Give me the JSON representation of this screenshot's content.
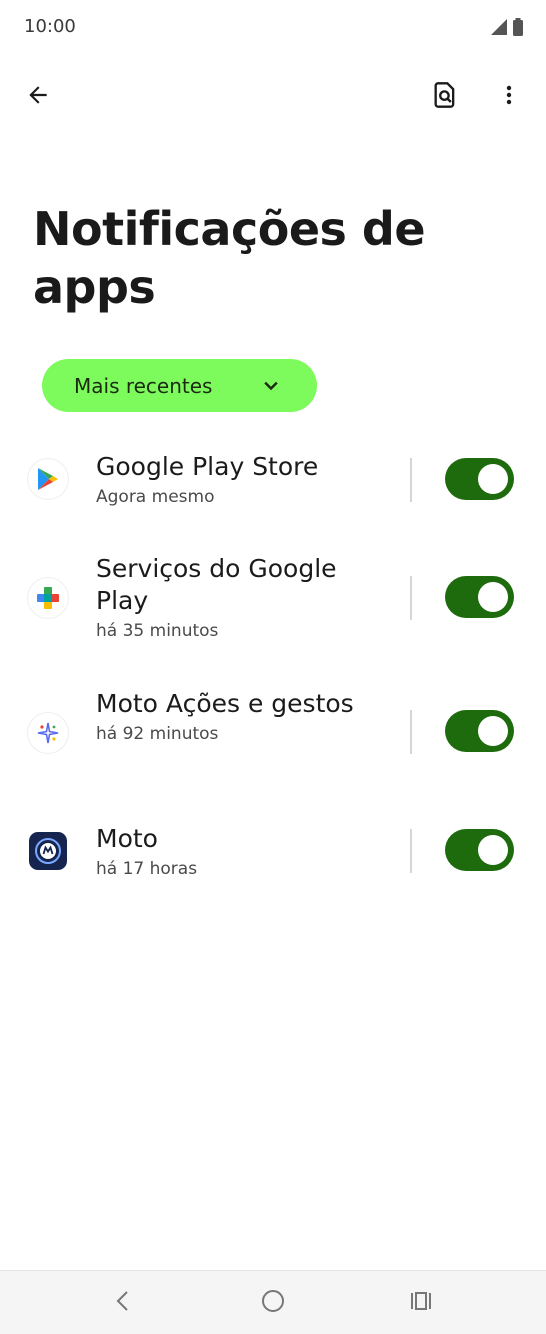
{
  "status_bar": {
    "time": "10:00",
    "icons": [
      "signal-icon",
      "battery-icon"
    ]
  },
  "app_bar": {
    "back_icon": "arrow-back-icon",
    "search_icon": "search-settings-icon",
    "more_icon": "more-vert-icon"
  },
  "page": {
    "title": "Notificações de apps"
  },
  "filter": {
    "selected": "Mais recentes",
    "icon": "chevron-down-icon"
  },
  "apps": [
    {
      "name": "Google Play Store",
      "time": "Agora mesmo",
      "icon": "google-play-store-icon",
      "enabled": true
    },
    {
      "name": "Serviços do Google Play",
      "time": "há 35 minutos",
      "icon": "google-play-services-icon",
      "enabled": true
    },
    {
      "name": "Moto Ações e gestos",
      "time": "há 92 minutos",
      "icon": "moto-actions-icon",
      "enabled": true
    },
    {
      "name": "Moto",
      "time": "há 17 horas",
      "icon": "moto-icon",
      "enabled": true
    }
  ],
  "nav_bar": {
    "icons": [
      "nav-back-icon",
      "nav-home-icon",
      "nav-recents-icon"
    ]
  },
  "colors": {
    "chip": "#7dfb5c",
    "toggle_on": "#1e6b0d"
  }
}
